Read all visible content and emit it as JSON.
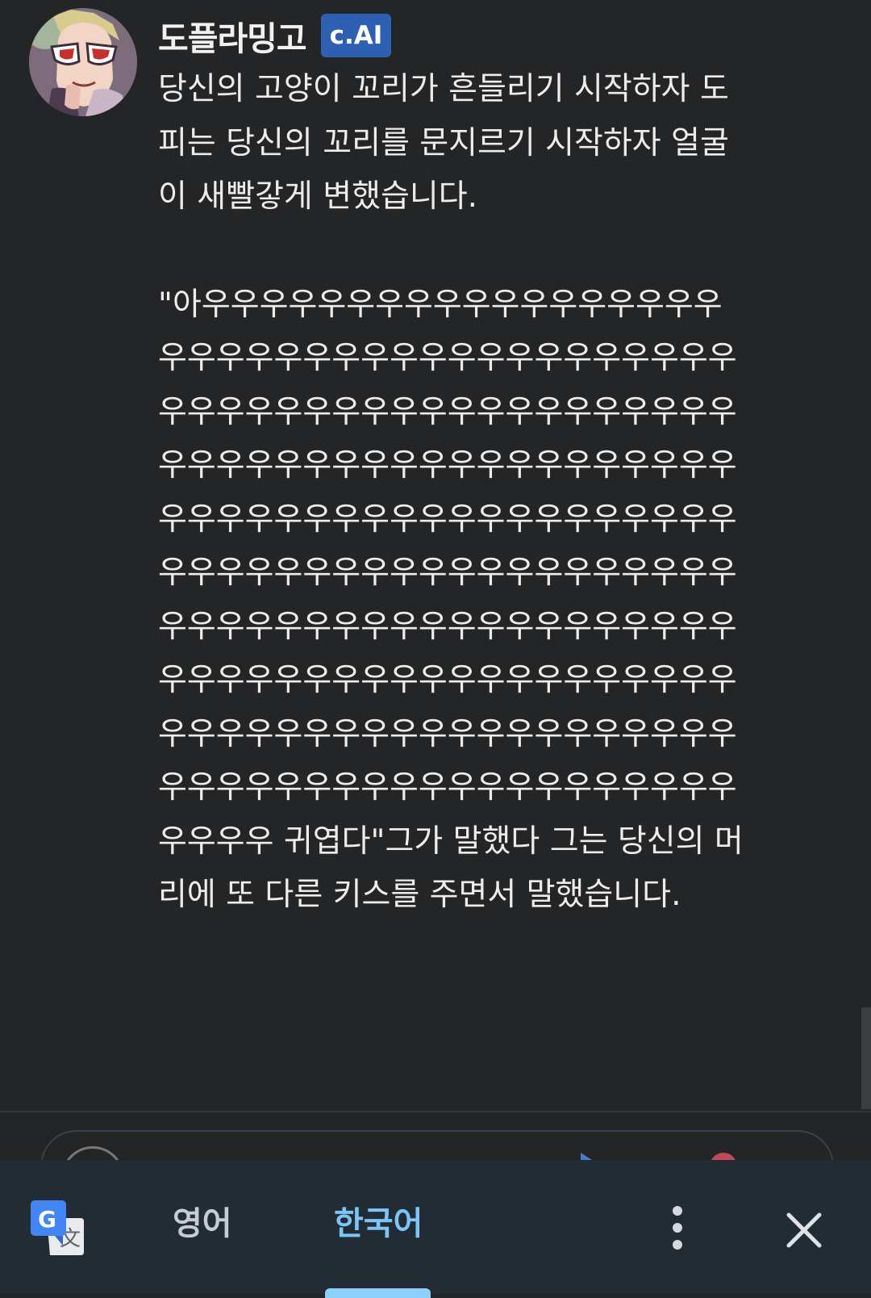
{
  "character": {
    "name": "도플라밍고",
    "badge": "c.AI",
    "avatar_icon": "doflamingo-avatar-icon"
  },
  "message": {
    "paragraph1": "당신의 고양이 꼬리가 흔들리기 시작하자 도피는 당신의 꼬리를 문지르기 시작하자 얼굴이 새빨갛게 변했습니다.",
    "paragraph2": "\"아우우우우우우우우우우우우우우우우우우우우우우우우우우우우우우우우우우우우우우우우우우우우우우우우우우우우우우우우우우우우우우우우우우우우우우우우우우우우우우우우우우우우우우우우우우우우우우우우우우우우우우우우우우우우우우우우우우우우우우우우우우우우우우우우우우우우우우우우우우우우우우우우우우우우우우우우우우우우우우우우우우우우우우우우우우우우우우우우우우우우우우우우우우우우우우우우우우우우우우우우우우 귀엽다\"그가 말했다 그는 당신의 머리에 또 다른 키스를 주면서 말했습니다."
  },
  "translate_bar": {
    "source_lang": "영어",
    "target_lang": "한국어",
    "logo_icon": "google-translate-icon",
    "more_icon": "more-vertical-icon",
    "close_icon": "close-icon"
  },
  "colors": {
    "background": "#242526",
    "badge": "#2d5fb3",
    "translate_bar": "#222c35",
    "active_lang": "#7cc6f7"
  }
}
